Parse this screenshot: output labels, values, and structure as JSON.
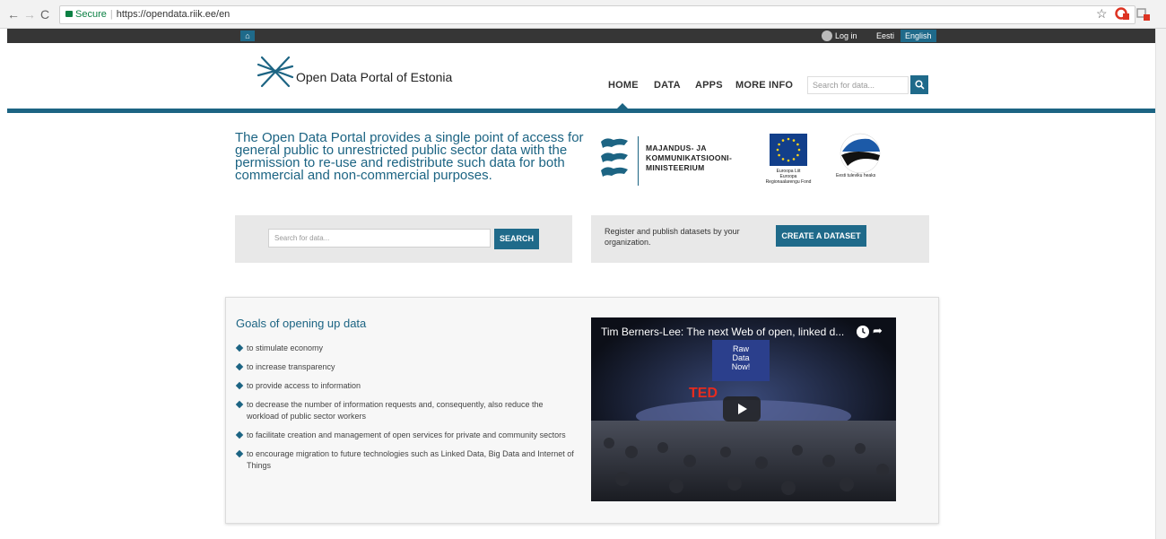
{
  "browser": {
    "secure_label": "Secure",
    "url": "https://opendata.riik.ee/en"
  },
  "topbar": {
    "login": "Log in",
    "lang_et": "Eesti",
    "lang_en": "English"
  },
  "header": {
    "logo_text": "Open Data Portal of Estonia",
    "menu": [
      "HOME",
      "DATA",
      "APPS",
      "MORE INFO"
    ],
    "search_placeholder": "Search for data..."
  },
  "intro": {
    "text": "The Open Data Portal provides a single point of access for general public to unrestricted public sector data with the permission to re-use and redistribute such data for both commercial and non-commercial purposes."
  },
  "partners": {
    "mkm_line1": "MAJANDUS- JA",
    "mkm_line2": "KOMMUNIKATSIOONI-",
    "mkm_line3": "MINISTEERIUM",
    "eu_line1": "Euroopa Liit",
    "eu_line2": "Euroopa",
    "eu_line3": "Regionaalarengu Fond",
    "ee_text": "Eesti tuleviku heaks"
  },
  "search_box": {
    "placeholder": "Search for data...",
    "button": "SEARCH"
  },
  "dataset_box": {
    "text": "Register and publish datasets by your organization.",
    "button": "CREATE A DATASET"
  },
  "goals": {
    "title": "Goals of opening up data",
    "items": [
      "to stimulate economy",
      "to increase transparency",
      "to provide access to information",
      "to decrease the number of information requests and, consequently, also reduce the workload of public sector workers",
      "to facilitate creation and management of open services for private and community sectors",
      "to encourage migration to future technologies such as Linked Data, Big Data and Internet of Things"
    ]
  },
  "video": {
    "title": "Tim Berners-Lee: The next Web of open, linked d...",
    "slide_line1": "Raw",
    "slide_line2": "Data",
    "slide_line3": "Now!",
    "brand": "TED"
  }
}
